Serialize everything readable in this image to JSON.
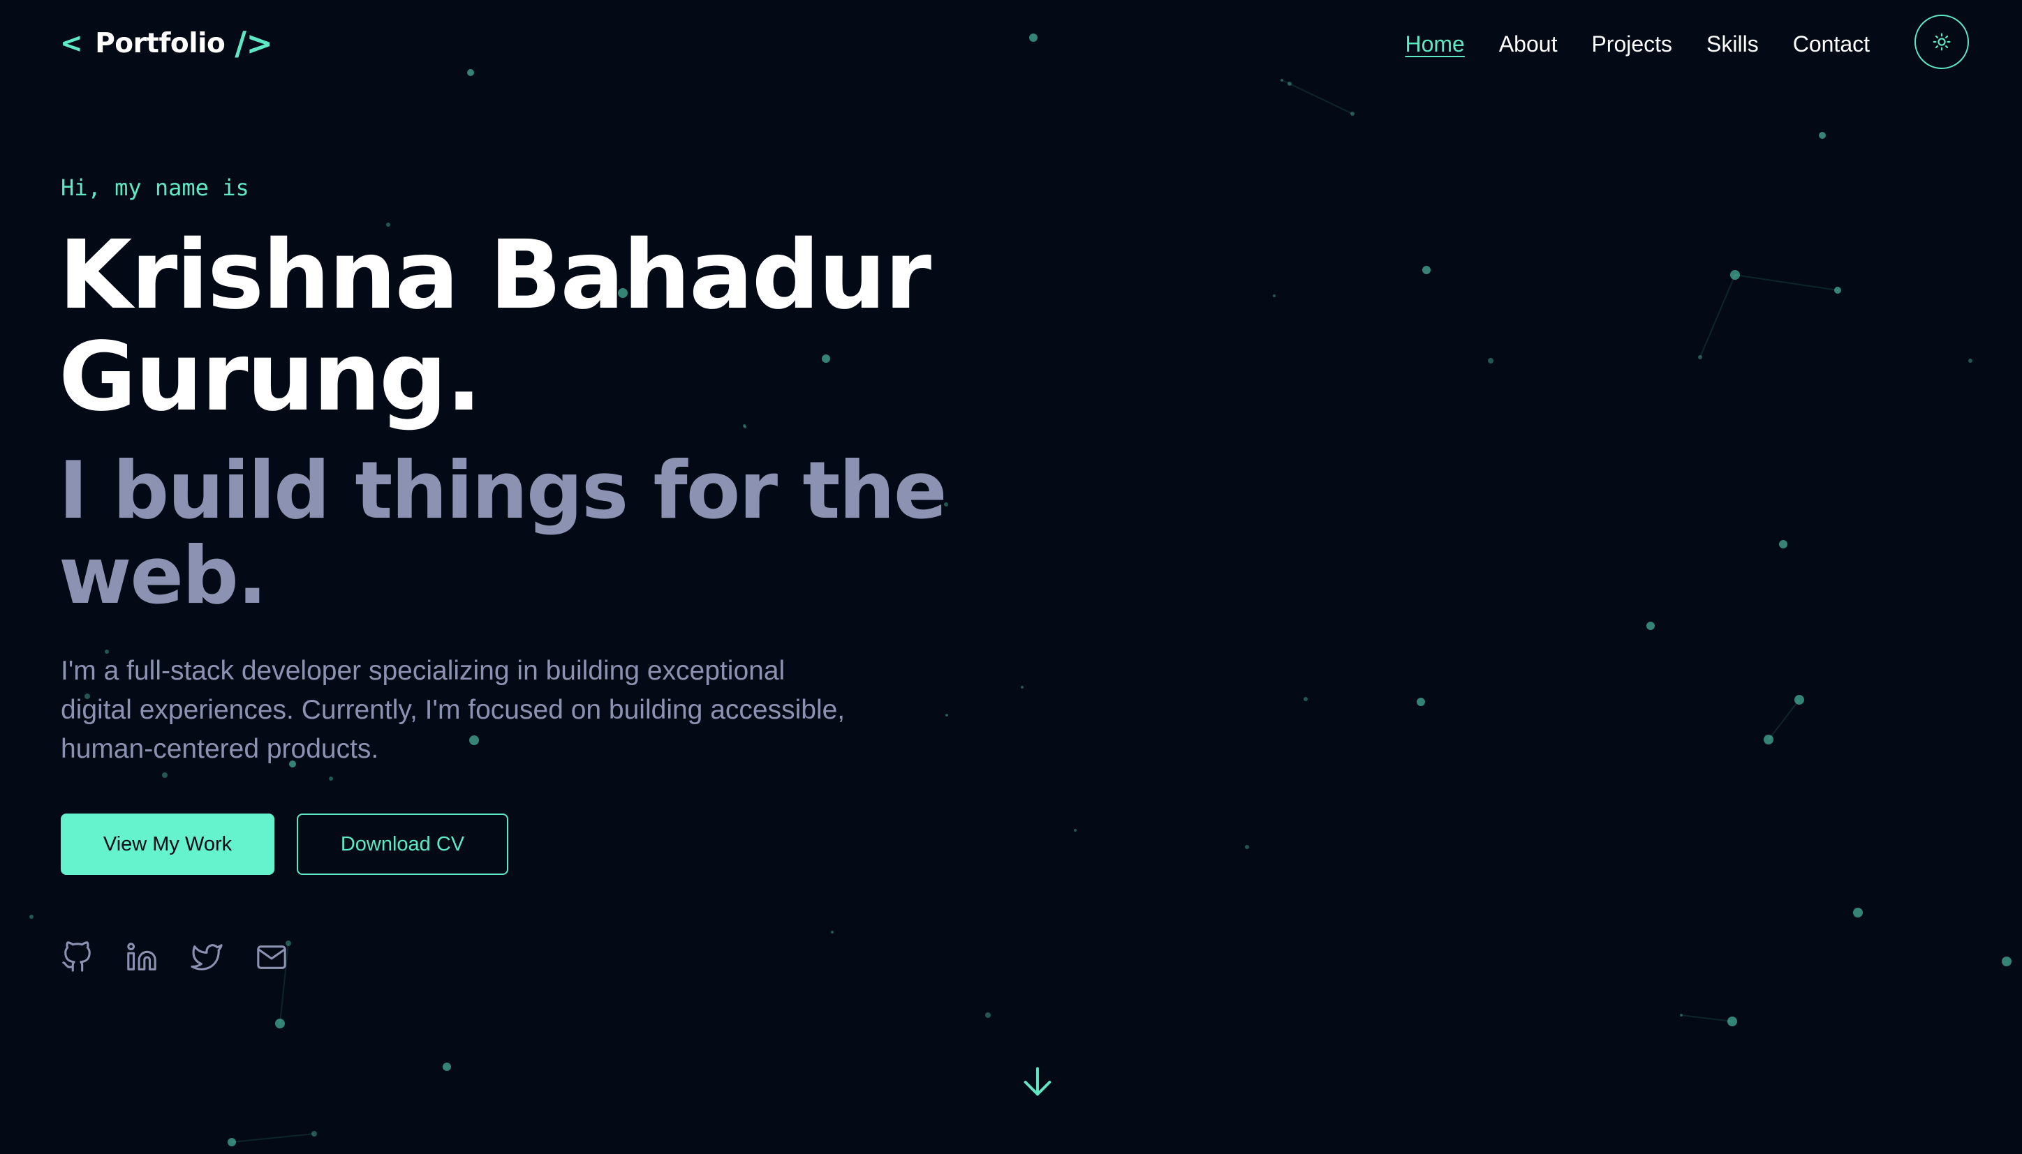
{
  "header": {
    "logo_left_bracket": "<",
    "logo_text": "Portfolio",
    "logo_right_bracket": "/>",
    "nav": [
      {
        "label": "Home",
        "active": true
      },
      {
        "label": "About",
        "active": false
      },
      {
        "label": "Projects",
        "active": false
      },
      {
        "label": "Skills",
        "active": false
      },
      {
        "label": "Contact",
        "active": false
      }
    ],
    "theme_toggle_icon": "sun-icon"
  },
  "hero": {
    "greeting": "Hi, my name is",
    "name_line1": "Krishna Bahadur",
    "name_line2": "Gurung.",
    "tagline_line1": "I build things for the",
    "tagline_line2": "web.",
    "description_line1": "I'm a full-stack developer specializing in building exceptional",
    "description_line2": "digital experiences. Currently, I'm focused on building accessible,",
    "description_line3": "human-centered products.",
    "primary_button": "View My Work",
    "secondary_button": "Download CV",
    "socials": [
      {
        "icon": "github-icon"
      },
      {
        "icon": "linkedin-icon"
      },
      {
        "icon": "twitter-icon"
      },
      {
        "icon": "mail-icon"
      }
    ],
    "scroll_icon": "arrow-down-icon"
  },
  "colors": {
    "background": "#030a16",
    "accent": "#5ee8c3",
    "accent_button": "#64f3cd",
    "muted_text": "#8c93b2",
    "heading": "#ffffff"
  }
}
